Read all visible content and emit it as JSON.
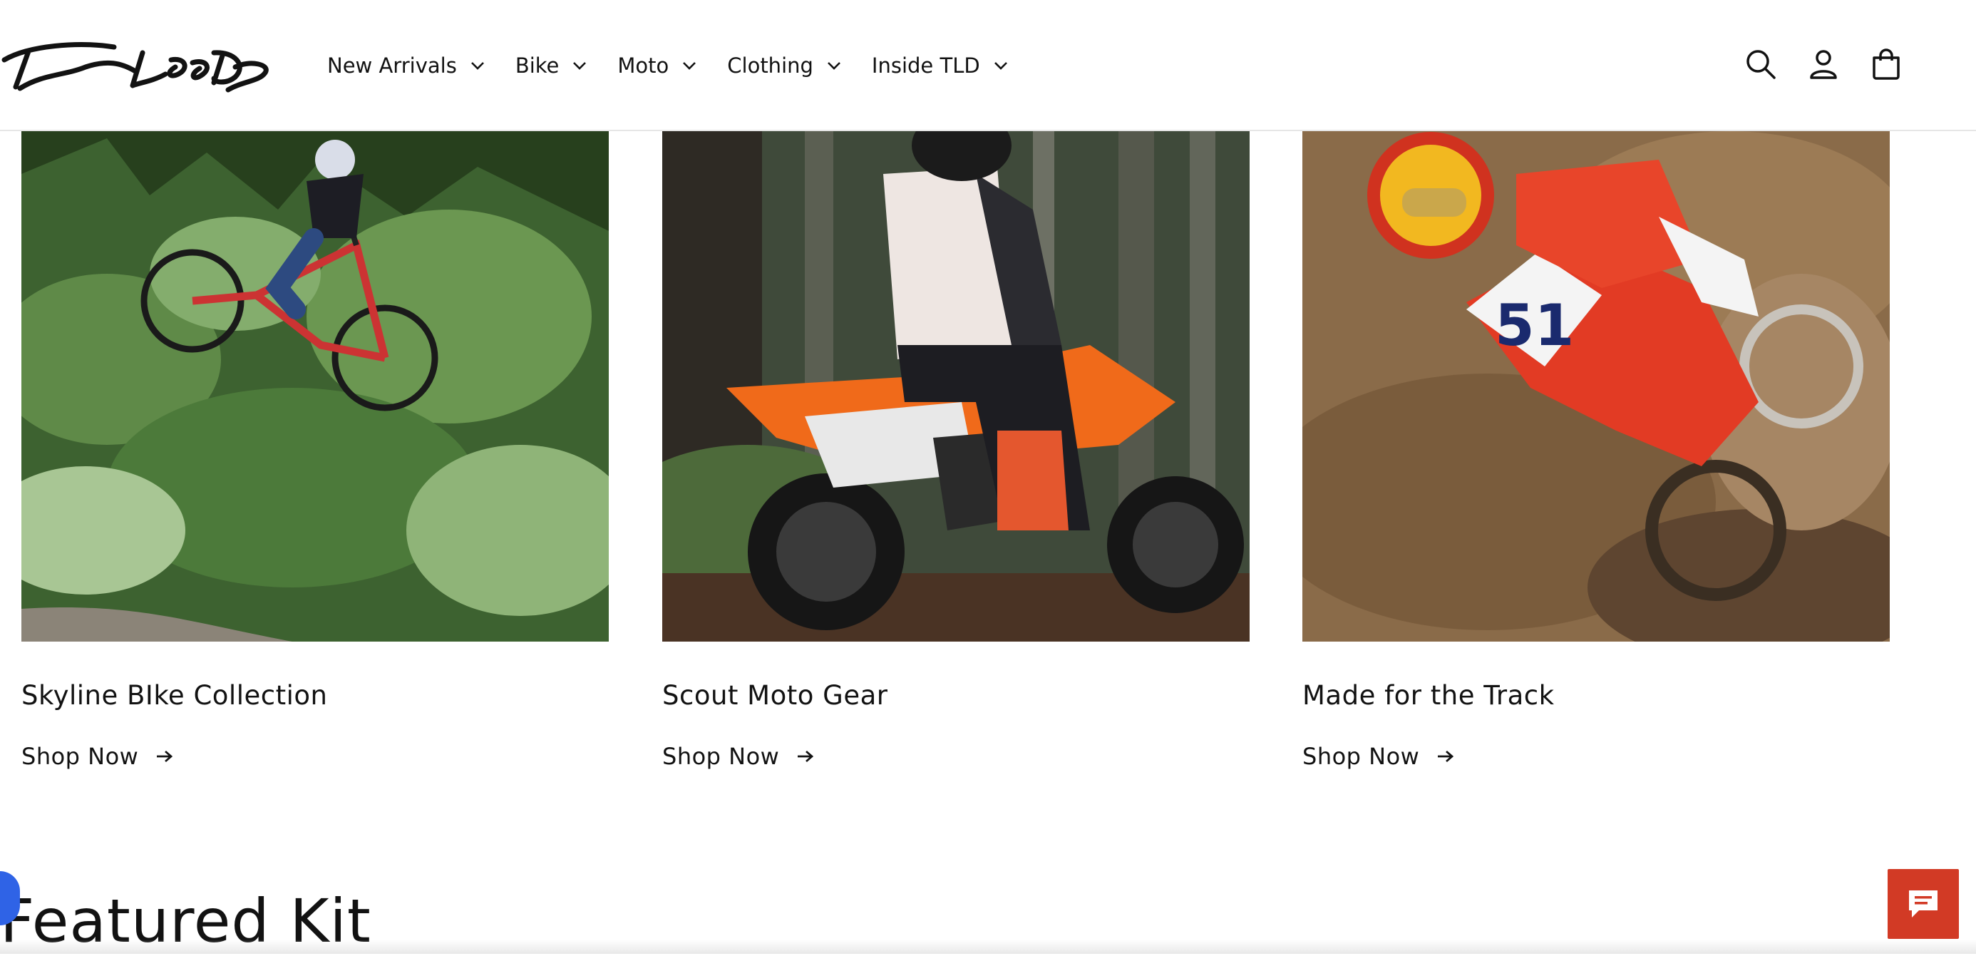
{
  "brand": {
    "logo_text": "Troy Lee Designs"
  },
  "nav": [
    {
      "label": "New Arrivals"
    },
    {
      "label": "Bike"
    },
    {
      "label": "Moto"
    },
    {
      "label": "Clothing"
    },
    {
      "label": "Inside TLD"
    }
  ],
  "header_icons": [
    "search-icon",
    "account-icon",
    "cart-icon"
  ],
  "cards": [
    {
      "title": "Skyline BIke Collection",
      "link": "Shop Now",
      "image": "downhill mountain bike rider in forest"
    },
    {
      "title": "Scout Moto Gear",
      "link": "Shop Now",
      "image": "orange dirt bike rider in forest"
    },
    {
      "title": "Made for the Track",
      "link": "Shop Now",
      "image": "motocross rider #51 on dirt track"
    }
  ],
  "featured": {
    "title": "Featured Kit"
  },
  "colors": {
    "accent_chat": "#d23a25",
    "a11y_badge": "#2f63e6",
    "text": "#121212"
  }
}
